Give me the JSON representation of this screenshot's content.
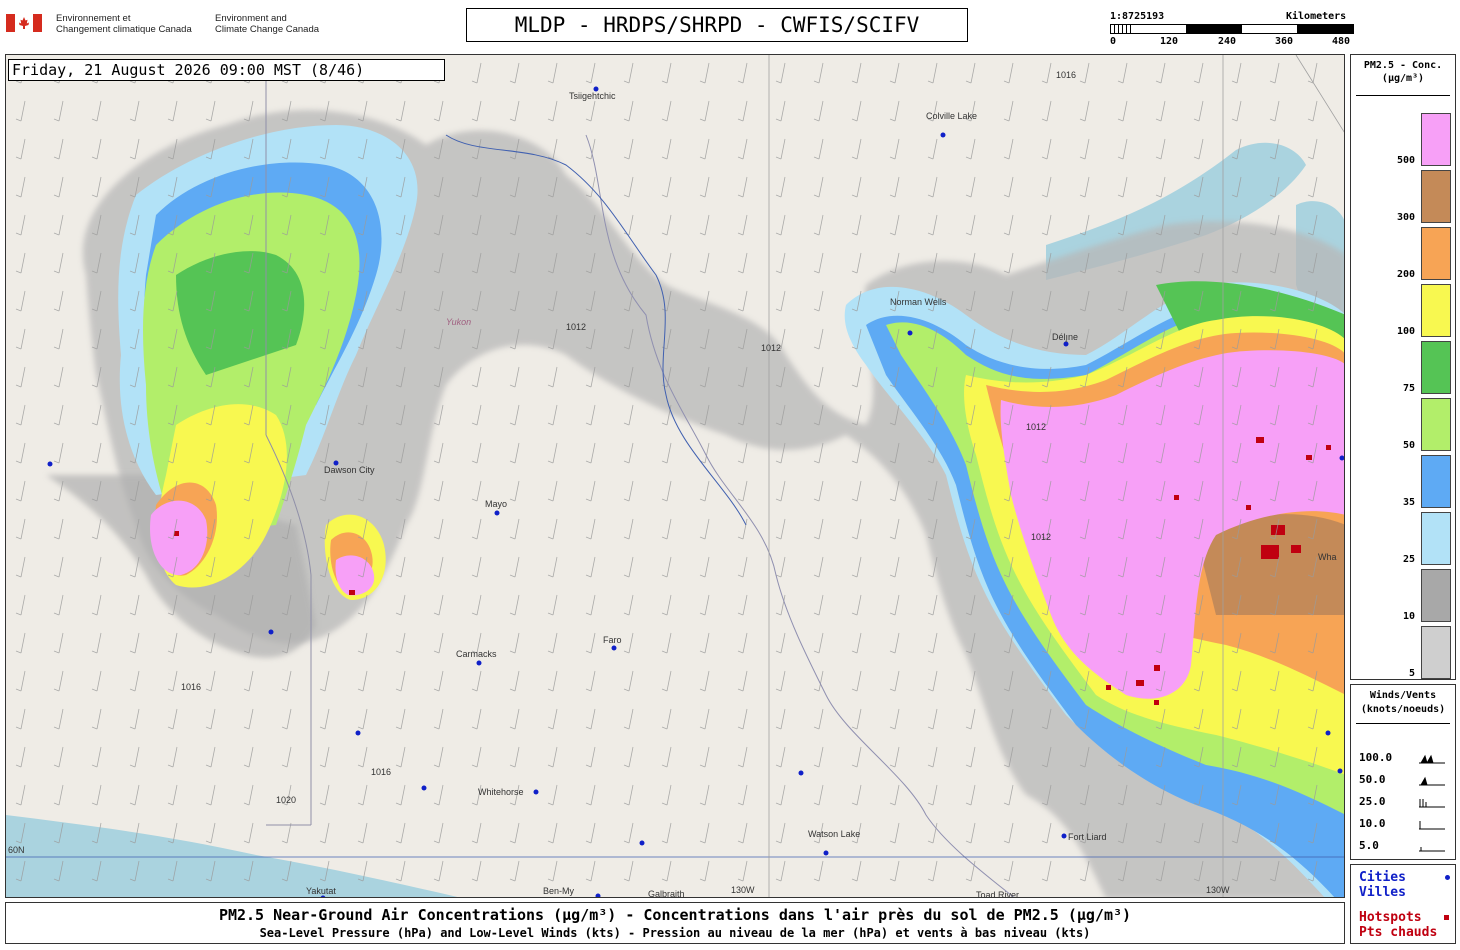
{
  "header": {
    "dept_fr": [
      "Environnement et",
      "Changement climatique Canada"
    ],
    "dept_en": [
      "Environment and",
      "Climate Change Canada"
    ],
    "title": "MLDP - HRDPS/SHRPD - CWFIS/SCIFV",
    "scale": {
      "ratio": "1:8725193",
      "unit": "Kilometers",
      "ticks": [
        "0",
        "120",
        "240",
        "360",
        "480"
      ]
    }
  },
  "map": {
    "timestamp": "Friday, 21 August 2026 09:00 MST (8/46)",
    "region_label": "Yukon",
    "places": [
      {
        "name": "Tsiigehtchic"
      },
      {
        "name": "Colville Lake"
      },
      {
        "name": "Dawson City"
      },
      {
        "name": "Mayo"
      },
      {
        "name": "Carmacks"
      },
      {
        "name": "Faro"
      },
      {
        "name": "Whitehorse"
      },
      {
        "name": "Watson Lake"
      },
      {
        "name": "Fort Liard"
      },
      {
        "name": "Norman Wells"
      },
      {
        "name": "Délı̨ne"
      },
      {
        "name": "Wha"
      },
      {
        "name": "Yakutat"
      },
      {
        "name": "Ben-My"
      },
      {
        "name": "Galbraith"
      },
      {
        "name": "Toad River"
      }
    ],
    "grid_labels": [
      "130W",
      "130W",
      "60N"
    ],
    "isobar_labels": [
      "1012",
      "1016",
      "1020"
    ]
  },
  "legend": {
    "title": [
      "PM2.5 - Conc.",
      "(μg/m³)"
    ],
    "bins": [
      {
        "label": "500",
        "color": "#f7a0f7"
      },
      {
        "label": "300",
        "color": "#c48a58"
      },
      {
        "label": "200",
        "color": "#f7a455"
      },
      {
        "label": "100",
        "color": "#f8f850"
      },
      {
        "label": "75",
        "color": "#55c455"
      },
      {
        "label": "50",
        "color": "#b2ee6a"
      },
      {
        "label": "35",
        "color": "#5eaaf4"
      },
      {
        "label": "25",
        "color": "#b2e2f7"
      },
      {
        "label": "10",
        "color": "#a8a8a8"
      },
      {
        "label": "5",
        "color": "#cfcfcf"
      }
    ]
  },
  "wind_legend": {
    "title": [
      "Winds/Vents",
      "(knots/noeuds)"
    ],
    "rows": [
      "100.0",
      "50.0",
      "25.0",
      "10.0",
      "5.0"
    ]
  },
  "city_legend": {
    "cities": [
      "Cities",
      "Villes"
    ],
    "hotspots": [
      "Hotspots",
      "Pts chauds"
    ],
    "city_color": "#1020c8",
    "hotspot_color": "#c00010"
  },
  "footer": {
    "line1": "PM2.5 Near-Ground Air Concentrations (μg/m³) - Concentrations dans l'air près du sol de PM2.5 (μg/m³)",
    "line2": "Sea-Level Pressure (hPa) and Low-Level Winds (kts) - Pression au niveau de la mer (hPa) et vents à bas niveau (kts)"
  }
}
